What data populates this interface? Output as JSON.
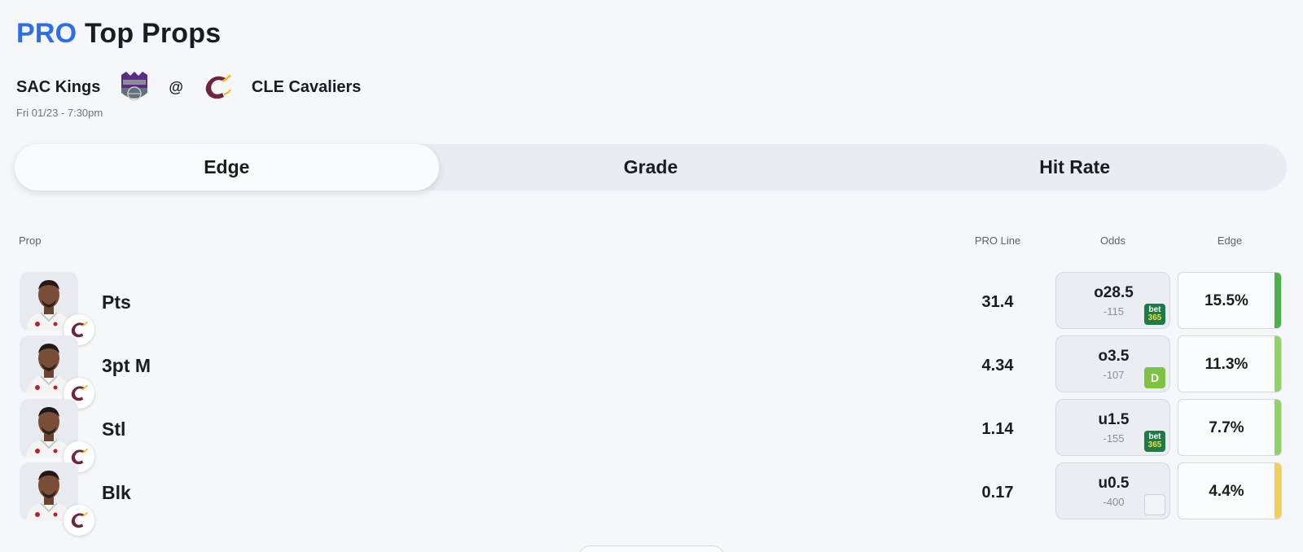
{
  "header": {
    "title_pro": "PRO",
    "title_rest": "Top Props"
  },
  "game": {
    "away_team": "SAC Kings",
    "away_logo_icon": "sacramento-kings-logo",
    "separator": "@",
    "home_team": "CLE Cavaliers",
    "home_logo_icon": "cleveland-cavaliers-logo",
    "datetime": "Fri 01/23 - 7:30pm"
  },
  "tabs": [
    {
      "label": "Edge",
      "active": true
    },
    {
      "label": "Grade",
      "active": false
    },
    {
      "label": "Hit Rate",
      "active": false
    }
  ],
  "columns": {
    "prop": "Prop",
    "pro_line": "PRO Line",
    "odds": "Odds",
    "edge": "Edge"
  },
  "colors": {
    "accent": "#2f6fe4",
    "edge_strong": "#4caf50",
    "edge_medium": "#8fd16a",
    "edge_low": "#f2cf5b"
  },
  "props": [
    {
      "stat": "Pts",
      "pro_line": "31.4",
      "odds_line": "o28.5",
      "odds_price": "-115",
      "book": "bet365",
      "book_text_1": "bet",
      "book_text_2": "365",
      "edge": "15.5%",
      "edge_color": "#4caf50"
    },
    {
      "stat": "3pt M",
      "pro_line": "4.34",
      "odds_line": "o3.5",
      "odds_price": "-107",
      "book": "draftkings",
      "book_text_1": "D",
      "book_text_2": "",
      "edge": "11.3%",
      "edge_color": "#8fd16a"
    },
    {
      "stat": "Stl",
      "pro_line": "1.14",
      "odds_line": "u1.5",
      "odds_price": "-155",
      "book": "bet365",
      "book_text_1": "bet",
      "book_text_2": "365",
      "edge": "7.7%",
      "edge_color": "#8fd16a"
    },
    {
      "stat": "Blk",
      "pro_line": "0.17",
      "odds_line": "u0.5",
      "odds_price": "-400",
      "book": "other",
      "book_text_1": "",
      "book_text_2": "",
      "edge": "4.4%",
      "edge_color": "#f2cf5b"
    }
  ]
}
